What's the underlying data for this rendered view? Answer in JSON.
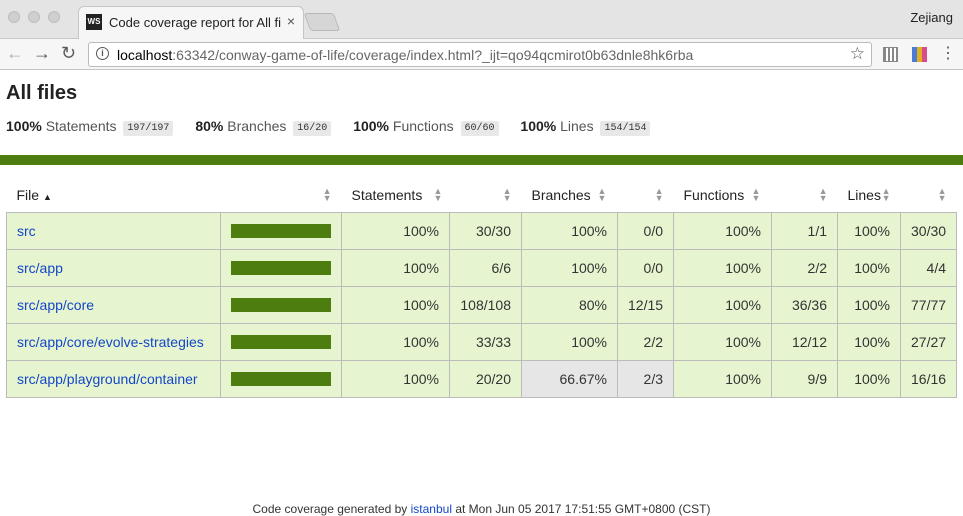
{
  "browser": {
    "tab_title": "Code coverage report for All files",
    "profile_name": "Zejiang",
    "url_host": "localhost",
    "url_rest": ":63342/conway-game-of-life/coverage/index.html?_ijt=qo94qcmirot0b63dnle8hk6rba"
  },
  "icons": {
    "back": "arrow-left-icon",
    "forward": "arrow-right-icon",
    "reload": "reload-icon",
    "info": "info-icon",
    "star": "star-icon",
    "menu": "three-dots-icon",
    "sort_asc": "sort-ascending-icon",
    "sort": "sort-icon"
  },
  "icon_glyphs": {
    "back": "←",
    "forward": "→",
    "reload": "↻",
    "info": "i",
    "star": "☆",
    "menu": "⋮",
    "close": "×",
    "sort_asc": "▲",
    "sort": "◆"
  },
  "colors": {
    "status_bar": "#4d7c0f",
    "row_high": "#e6f5d0",
    "row_medium": "#e6e6e6",
    "link": "#1446c8"
  },
  "report": {
    "title": "All files",
    "summary": [
      {
        "pct": "100%",
        "label": "Statements",
        "fraction": "197/197"
      },
      {
        "pct": "80%",
        "label": "Branches",
        "fraction": "16/20"
      },
      {
        "pct": "100%",
        "label": "Functions",
        "fraction": "60/60"
      },
      {
        "pct": "100%",
        "label": "Lines",
        "fraction": "154/154"
      }
    ],
    "columns": {
      "file": "File",
      "statements": "Statements",
      "branches": "Branches",
      "functions": "Functions",
      "lines": "Lines"
    },
    "rows": [
      {
        "file": "src",
        "coverage_fraction": 1.0,
        "stmt_pct": "100%",
        "stmt": "30/30",
        "branch_pct": "100%",
        "branch": "0/0",
        "func_pct": "100%",
        "func": "1/1",
        "line_pct": "100%",
        "line": "30/30",
        "branch_medium": false
      },
      {
        "file": "src/app",
        "coverage_fraction": 1.0,
        "stmt_pct": "100%",
        "stmt": "6/6",
        "branch_pct": "100%",
        "branch": "0/0",
        "func_pct": "100%",
        "func": "2/2",
        "line_pct": "100%",
        "line": "4/4",
        "branch_medium": false
      },
      {
        "file": "src/app/core",
        "coverage_fraction": 1.0,
        "stmt_pct": "100%",
        "stmt": "108/108",
        "branch_pct": "80%",
        "branch": "12/15",
        "func_pct": "100%",
        "func": "36/36",
        "line_pct": "100%",
        "line": "77/77",
        "branch_medium": false
      },
      {
        "file": "src/app/core/evolve-strategies",
        "coverage_fraction": 1.0,
        "stmt_pct": "100%",
        "stmt": "33/33",
        "branch_pct": "100%",
        "branch": "2/2",
        "func_pct": "100%",
        "func": "12/12",
        "line_pct": "100%",
        "line": "27/27",
        "branch_medium": false
      },
      {
        "file": "src/app/playground/container",
        "coverage_fraction": 1.0,
        "stmt_pct": "100%",
        "stmt": "20/20",
        "branch_pct": "66.67%",
        "branch": "2/3",
        "func_pct": "100%",
        "func": "9/9",
        "line_pct": "100%",
        "line": "16/16",
        "branch_medium": true
      }
    ],
    "footer_prefix": "Code coverage generated by",
    "footer_link": "istanbul",
    "footer_suffix": "at Mon Jun 05 2017 17:51:55 GMT+0800 (CST)"
  }
}
